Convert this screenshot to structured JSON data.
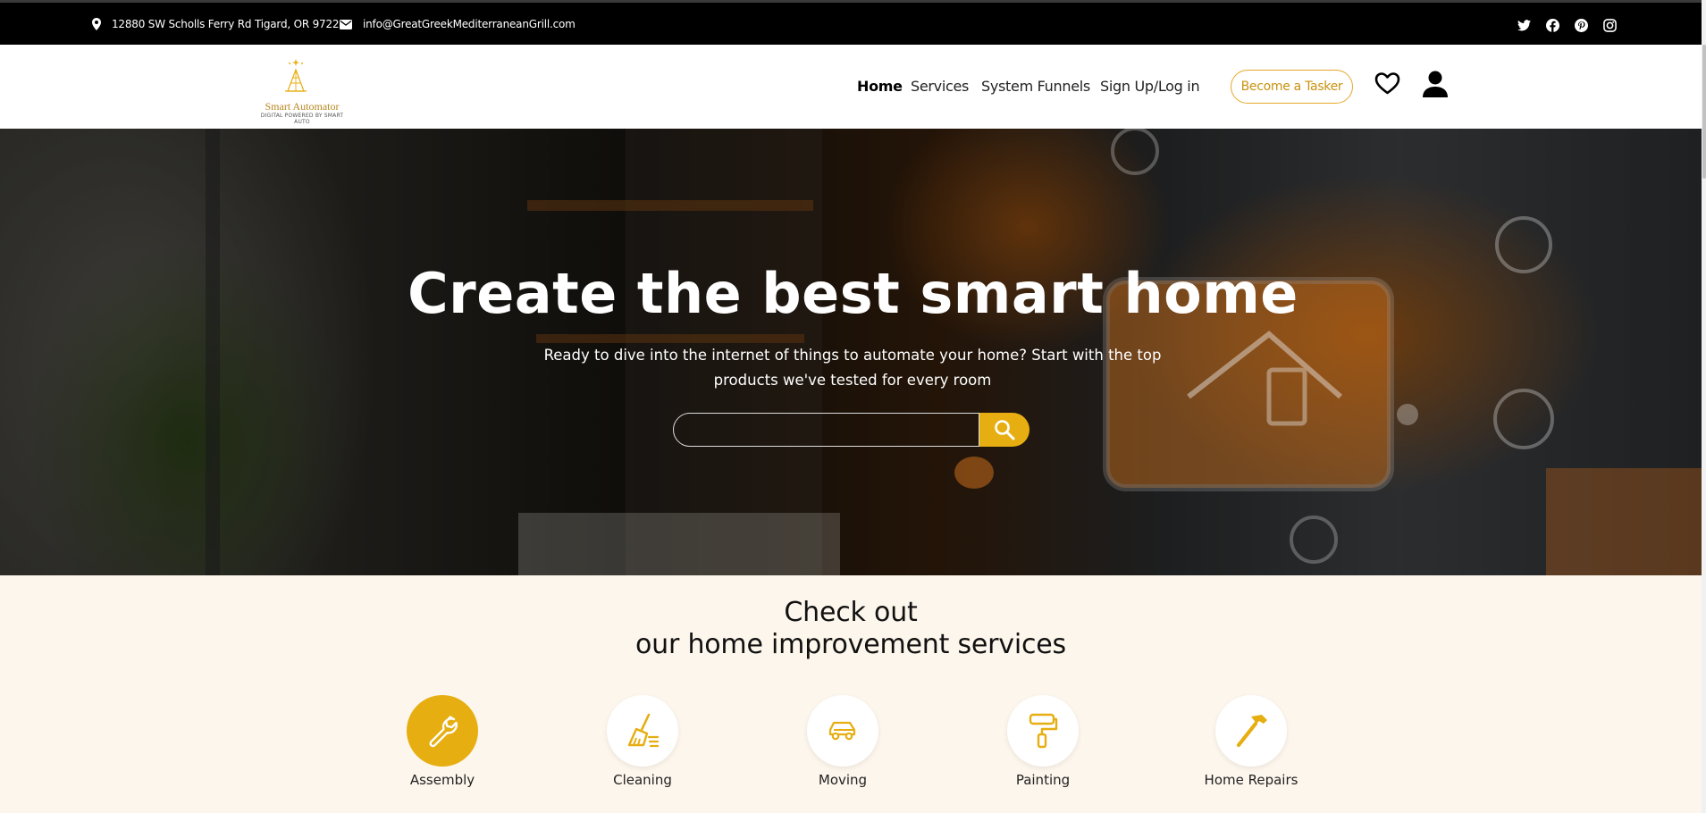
{
  "topbar": {
    "address": "12880 SW Scholls Ferry Rd Tigard, OR 97223",
    "email": "info@GreatGreekMediterraneanGrill.com",
    "social": [
      "twitter-icon",
      "facebook-icon",
      "pinterest-icon",
      "instagram-icon"
    ]
  },
  "logo": {
    "name": "Smart Automator",
    "tagline": "DIGITAL POWERED BY SMART AUTO"
  },
  "nav": {
    "items": [
      "Home",
      "Services",
      "System Funnels",
      "Sign Up/Log in"
    ],
    "active": "Home",
    "cta": "Become a Tasker"
  },
  "hero": {
    "title": "Create the best smart home",
    "subtitle": "Ready to dive into the internet of things to automate your home? Start with the top products we've tested for every room",
    "search_placeholder": ""
  },
  "services": {
    "title_line1": "Check out",
    "title_line2": "our home improvement services",
    "items": [
      {
        "label": "Assembly",
        "icon": "wrench-icon",
        "active": true
      },
      {
        "label": "Cleaning",
        "icon": "broom-icon",
        "active": false
      },
      {
        "label": "Moving",
        "icon": "car-icon",
        "active": false
      },
      {
        "label": "Painting",
        "icon": "paint-roller-icon",
        "active": false
      },
      {
        "label": "Home Repairs",
        "icon": "hammer-icon",
        "active": false
      }
    ]
  },
  "colors": {
    "accent": "#e7ae12",
    "topbar": "#000000",
    "section_bg": "#fdf6ec"
  }
}
